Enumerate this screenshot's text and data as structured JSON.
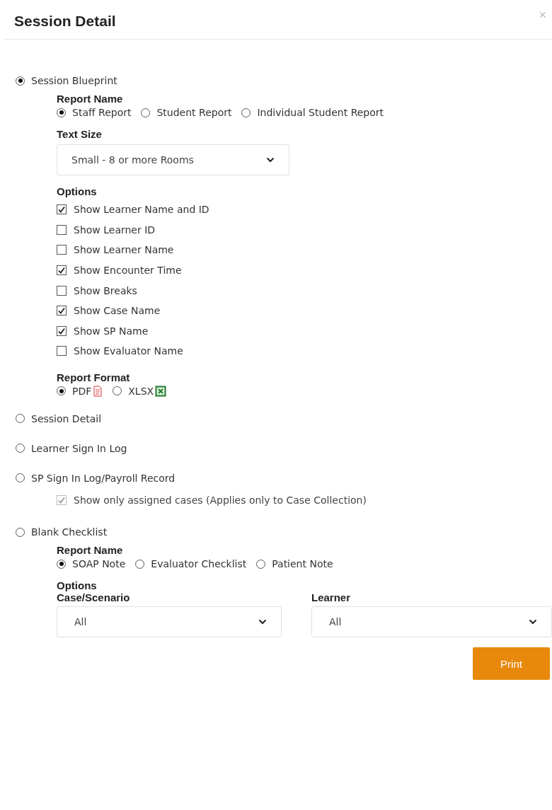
{
  "header": {
    "title": "Session Detail",
    "close": "×"
  },
  "reports": [
    {
      "label": "Session Blueprint",
      "selected": true,
      "sections": [
        {
          "kind": "radios",
          "title": "Report Name",
          "options": [
            {
              "label": "Staff Report",
              "selected": true
            },
            {
              "label": "Student Report",
              "selected": false
            },
            {
              "label": "Individual Student Report",
              "selected": false
            }
          ]
        },
        {
          "kind": "select",
          "title": "Text Size",
          "value": "Small - 8 or more Rooms"
        },
        {
          "kind": "checks",
          "title": "Options",
          "options": [
            {
              "label": "Show Learner Name and ID",
              "checked": true
            },
            {
              "label": "Show Learner ID",
              "checked": false
            },
            {
              "label": "Show Learner Name",
              "checked": false
            },
            {
              "label": "Show Encounter Time",
              "checked": true
            },
            {
              "label": "Show Breaks",
              "checked": false
            },
            {
              "label": "Show Case Name",
              "checked": true
            },
            {
              "label": "Show SP Name",
              "checked": true
            },
            {
              "label": "Show Evaluator Name",
              "checked": false
            }
          ]
        },
        {
          "kind": "radios",
          "title": "Report Format",
          "options": [
            {
              "label": "PDF",
              "selected": true,
              "kind": "pdf"
            },
            {
              "label": "XLSX",
              "selected": false,
              "kind": "xlsx"
            }
          ]
        }
      ]
    },
    {
      "label": "Session Detail",
      "selected": false
    },
    {
      "label": "Learner Sign In Log",
      "selected": false
    },
    {
      "label": "SP Sign In Log/Payroll Record",
      "selected": false,
      "sections": [
        {
          "kind": "check",
          "label": "Show only assigned cases (Applies only to Case Collection)",
          "checked": true,
          "disabled": true
        }
      ]
    },
    {
      "label": "Blank Checklist",
      "selected": false,
      "sections": [
        {
          "kind": "radios",
          "title": "Report Name",
          "options": [
            {
              "label": "SOAP Note",
              "selected": true
            },
            {
              "label": "Evaluator Checklist",
              "selected": false
            },
            {
              "label": "Patient Note",
              "selected": false
            }
          ]
        },
        {
          "kind": "selects",
          "title": "Options",
          "fields": [
            {
              "label": "Case/Scenario",
              "value": "All"
            },
            {
              "label": "Learner",
              "value": "All"
            }
          ]
        }
      ]
    }
  ],
  "print_button": "Print"
}
